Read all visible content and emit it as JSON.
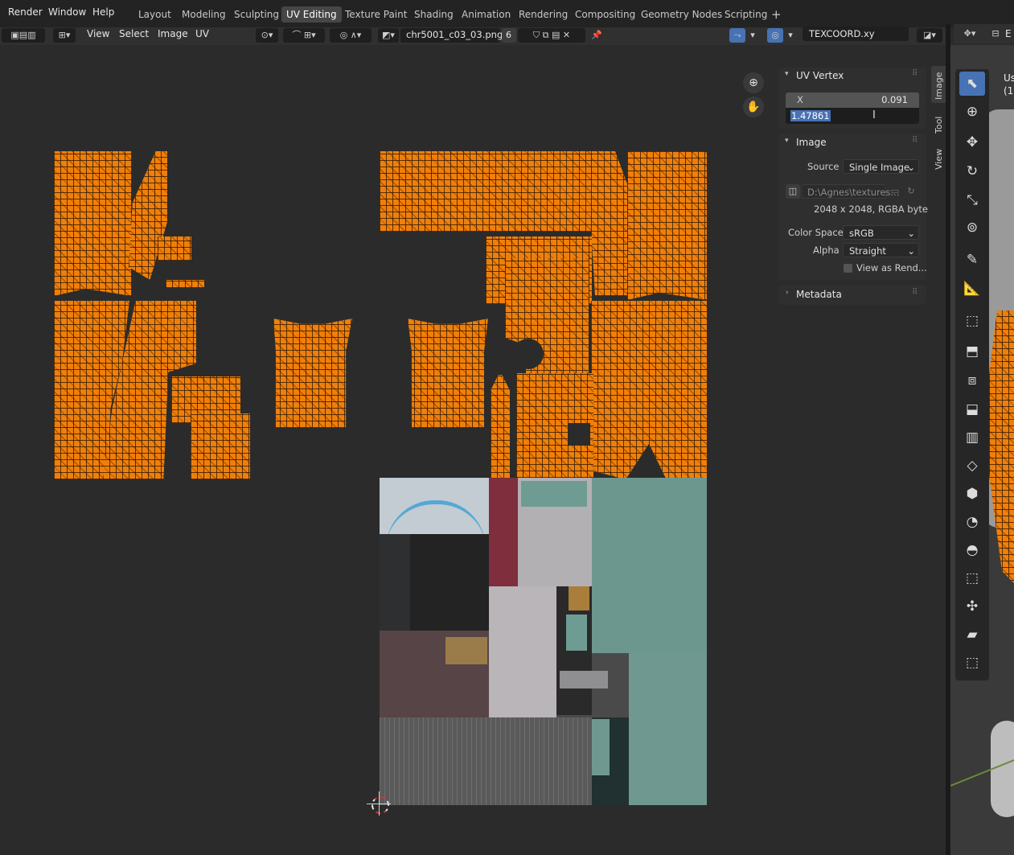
{
  "top_menu": [
    "Render",
    "Window",
    "Help"
  ],
  "workspaces": [
    "Layout",
    "Modeling",
    "Sculpting",
    "UV Editing",
    "Texture Paint",
    "Shading",
    "Animation",
    "Rendering",
    "Compositing",
    "Geometry Nodes",
    "Scripting"
  ],
  "active_workspace": "UV Editing",
  "add_tab": "+",
  "header_menus": [
    "View",
    "Select",
    "Image",
    "UV"
  ],
  "image_name": "chr5001_c03_03.png",
  "image_users": "6",
  "uv_map": "TEXCOORD.xy",
  "side_tabs": [
    "Image",
    "Tool",
    "View"
  ],
  "uv_vertex": {
    "title": "UV Vertex",
    "x_label": "X",
    "x_value": "0.091",
    "y_editing": "1.47861"
  },
  "image_panel": {
    "title": "Image",
    "source_label": "Source",
    "source_value": "Single Image",
    "path": "D:\\Agnes\\textures...",
    "info": "2048 x 2048,  RGBA byte",
    "colorspace_label": "Color Space",
    "colorspace_value": "sRGB",
    "alpha_label": "Alpha",
    "alpha_value": "Straight",
    "view_as_render": "View as Rend..."
  },
  "metadata_title": "Metadata",
  "viewport_text": [
    "Us",
    "(1)"
  ],
  "viewport_right_menu": "E",
  "colors": {
    "uv_orange": "#f07f0a",
    "accent_blue": "#4772b3",
    "active_tool": "#4772b3"
  }
}
